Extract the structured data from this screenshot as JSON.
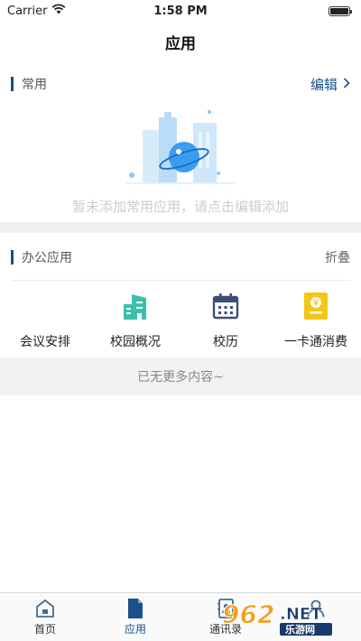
{
  "status_bar": {
    "carrier": "Carrier",
    "time": "1:58 PM"
  },
  "nav": {
    "title": "应用"
  },
  "common": {
    "title": "常用",
    "edit_label": "编辑",
    "empty_text": "暂未添加常用应用，请点击编辑添加"
  },
  "office": {
    "title": "办公应用",
    "fold_label": "折叠",
    "apps": [
      {
        "label": "会议安排",
        "icon": "meeting-icon"
      },
      {
        "label": "校园概况",
        "icon": "campus-building-icon",
        "color": "#3bbfad"
      },
      {
        "label": "校历",
        "icon": "calendar-icon",
        "color": "#3b4f7a"
      },
      {
        "label": "一卡通消费",
        "icon": "card-payment-icon",
        "color": "#f5c518"
      }
    ],
    "no_more_text": "已无更多内容~"
  },
  "tabs": [
    {
      "label": "首页",
      "icon": "home-icon"
    },
    {
      "label": "应用",
      "icon": "app-doc-icon",
      "active": true
    },
    {
      "label": "通讯录",
      "icon": "contacts-icon"
    },
    {
      "label": "我的",
      "icon": "profile-icon"
    }
  ],
  "colors": {
    "accent": "#1a4f8b",
    "teal": "#3bbfad",
    "yellow": "#f5c518",
    "navy": "#3b4f7a"
  },
  "watermark": {
    "digits": "962",
    "suffix": ".NET",
    "brand": "乐游网"
  }
}
